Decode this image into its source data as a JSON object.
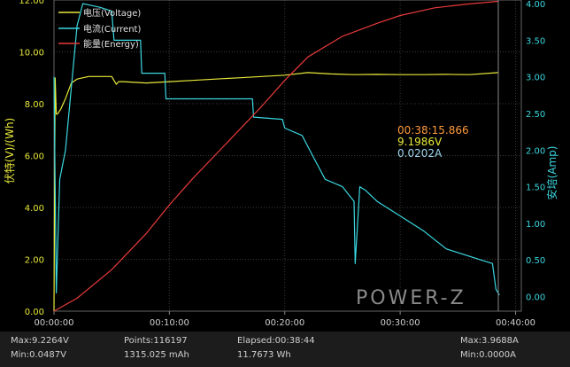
{
  "chart_data": {
    "type": "line",
    "x_ticks": [
      "00:00:00",
      "00:10:00",
      "00:20:00",
      "00:30:00",
      "00:40:00"
    ],
    "x_range_min": [
      0,
      40.5
    ],
    "y_left": {
      "label": "伏特(V)/(Wh)",
      "ticks": [
        "0.00",
        "2.00",
        "4.00",
        "6.00",
        "8.00",
        "10.00",
        "12.00"
      ],
      "range": [
        0,
        12
      ]
    },
    "y_right": {
      "label": "安培(Amp)",
      "ticks": [
        "0.00",
        "0.50",
        "1.00",
        "1.50",
        "2.00",
        "2.50",
        "3.00",
        "3.50",
        "4.00"
      ],
      "range": [
        -0.2,
        4.05
      ]
    },
    "grid": true,
    "legend": "top-left",
    "series": [
      {
        "name": "电压(Voltage)",
        "axis": "left",
        "color": "#e8e83a",
        "x": [
          0,
          0.1,
          0.2,
          0.3,
          0.6,
          1.0,
          1.5,
          2.0,
          3.0,
          5.0,
          5.4,
          5.6,
          6,
          8,
          10,
          12,
          14,
          16,
          18,
          20,
          22,
          24,
          26,
          28,
          30,
          32,
          34,
          36,
          38.5
        ],
        "y": [
          0.0,
          9.0,
          7.6,
          7.6,
          7.8,
          8.2,
          8.8,
          8.95,
          9.05,
          9.05,
          8.75,
          8.85,
          8.85,
          8.8,
          8.85,
          8.9,
          8.95,
          9.0,
          9.05,
          9.1,
          9.2,
          9.15,
          9.12,
          9.13,
          9.12,
          9.12,
          9.13,
          9.12,
          9.2
        ]
      },
      {
        "name": "电流(Current)",
        "axis": "right",
        "color": "#3ad8e0",
        "x": [
          0,
          0.2,
          0.4,
          0.5,
          1.0,
          2.0,
          2.5,
          4.0,
          5.0,
          5.2,
          7.5,
          7.6,
          9.6,
          9.7,
          17.2,
          17.3,
          19.8,
          20.0,
          21.5,
          22.5,
          23.5,
          25.0,
          26.0,
          26.1,
          26.5,
          27.0,
          28.0,
          30.0,
          32.0,
          34.0,
          36.0,
          38.0,
          38.3,
          38.6
        ],
        "y": [
          3.0,
          0.05,
          1.1,
          1.6,
          2.0,
          3.7,
          4.0,
          3.95,
          3.9,
          3.5,
          3.5,
          3.05,
          3.05,
          2.7,
          2.7,
          2.45,
          2.42,
          2.3,
          2.2,
          1.9,
          1.6,
          1.5,
          1.3,
          0.45,
          1.5,
          1.45,
          1.3,
          1.1,
          0.9,
          0.65,
          0.55,
          0.45,
          0.1,
          0.02
        ]
      },
      {
        "name": "能量(Energy)",
        "axis": "left",
        "color": "#e83a3a",
        "x": [
          0,
          2,
          5,
          8,
          10,
          12,
          15,
          18,
          20,
          22,
          25,
          28,
          30,
          33,
          36,
          38.5
        ],
        "y": [
          0.0,
          0.5,
          1.6,
          3.0,
          4.1,
          5.1,
          6.5,
          7.9,
          8.9,
          9.8,
          10.6,
          11.1,
          11.4,
          11.7,
          11.85,
          11.95
        ]
      }
    ]
  },
  "cursor": {
    "time": "00:38:15.866",
    "voltage": "9.1986V",
    "current": "0.0202A"
  },
  "colors": {
    "time_readout": "#ff9a3c",
    "voltage_readout": "#e8e83a",
    "current_readout": "#9fd8f0"
  },
  "logo": "POWER-Z",
  "stats": {
    "max_v": "Max:9.2264V",
    "min_v": "Min:0.0487V",
    "points": "Points:116197",
    "capacity": "1315.025 mAh",
    "elapsed": "Elapsed:00:38:44",
    "energy": "11.7673 Wh",
    "max_a": "Max:3.9688A",
    "min_a": "Min:0.0000A"
  }
}
